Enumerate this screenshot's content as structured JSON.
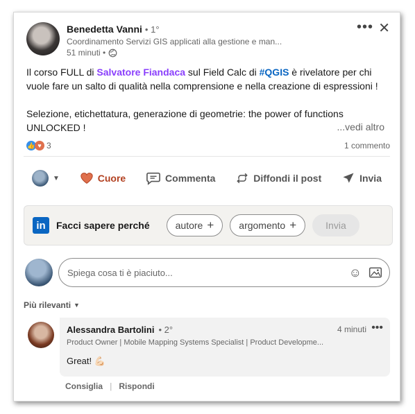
{
  "post": {
    "author": {
      "name": "Benedetta Vanni",
      "degree": "• 1°",
      "headline": "Coordinamento Servizi GIS applicati alla gestione e man...",
      "time": "51 minuti •"
    },
    "menu": {
      "more": "•••",
      "close": "✕"
    },
    "text": {
      "p1_prefix": "Il corso FULL di ",
      "mention": "Salvatore Fiandaca",
      "p1_mid": " sul Field Calc di ",
      "hashtag": "#QGIS",
      "p1_suffix": " è rivelatore per chi vuole fare un salto di qualità nella comprensione e nella creazione di espressioni !",
      "p2": "Selezione, etichettatura, generazione di geometrie: the power of functions UNLOCKED !"
    },
    "see_more": "...vedi altro",
    "reactions": {
      "count": "3",
      "comments": "1 commento"
    }
  },
  "actions": {
    "like": "Cuore",
    "comment": "Commenta",
    "repost": "Diffondi il post",
    "send": "Invia"
  },
  "feedback": {
    "label": "Facci sapere perché",
    "pill1": "autore",
    "pill2": "argomento",
    "pill3": "Invia"
  },
  "comment_input": {
    "placeholder": "Spiega cosa ti è piaciuto..."
  },
  "sort": {
    "label": "Più rilevanti"
  },
  "comment": {
    "name": "Alessandra Bartolini",
    "degree": "• 2°",
    "time": "4 minuti",
    "more": "•••",
    "headline": "Product Owner | Mobile Mapping Systems Specialist | Product Developme...",
    "text": "Great! 💪🏻",
    "like": "Consiglia",
    "reply": "Rispondi"
  },
  "colors": {
    "accent": "#0a66c2",
    "mention": "#8a3ffc",
    "heart": "#b24020"
  }
}
